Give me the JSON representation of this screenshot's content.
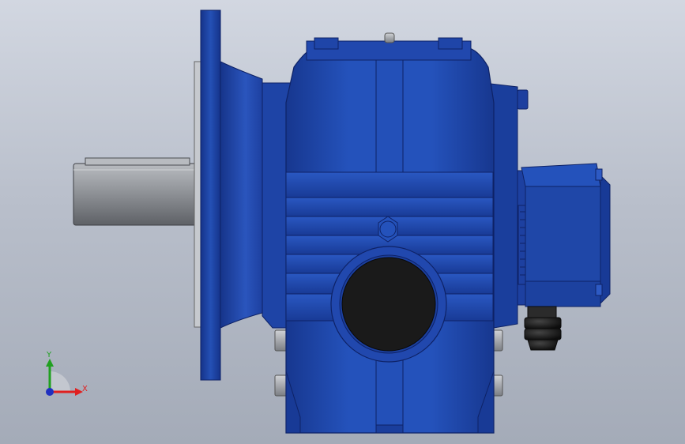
{
  "viewport": {
    "background_top": "#d2d7e1",
    "background_bottom": "#a4abb8"
  },
  "model": {
    "body_color": "#1f47a8",
    "shaft_color": "#8a8d92",
    "bore_color": "#1a1a1a",
    "motor_color": "#1f47a8"
  },
  "triad": {
    "x_label": "X",
    "y_label": "Y",
    "x_color": "#e02020",
    "y_color": "#20a020",
    "z_color": "#2030c0"
  }
}
